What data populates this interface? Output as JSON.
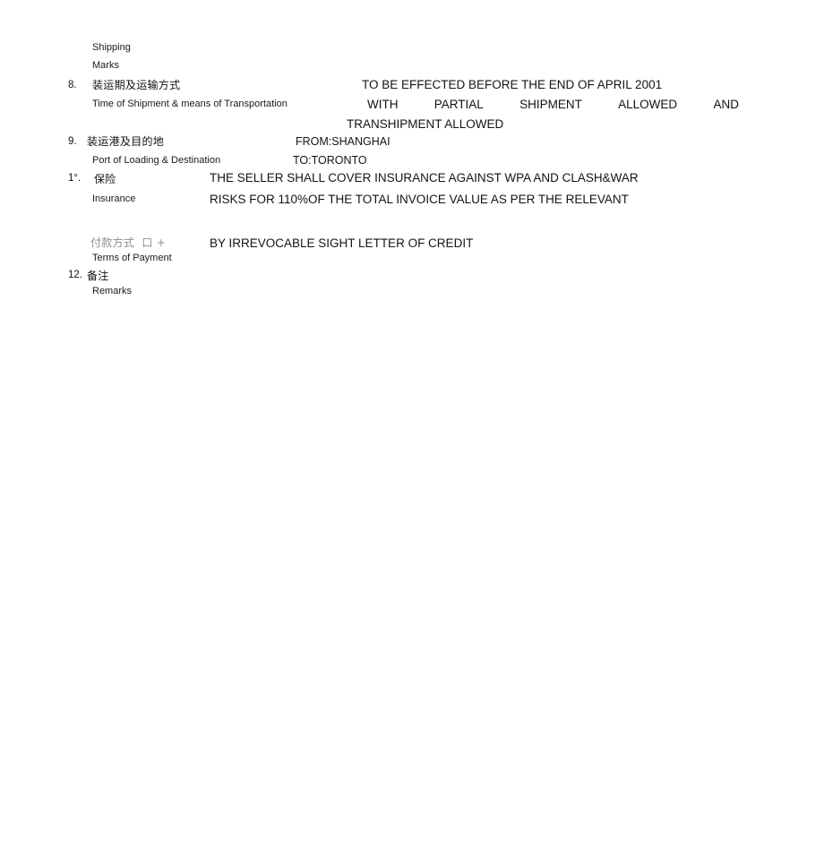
{
  "document": {
    "type": "sales-contract-fragment",
    "page_background": "#ffffff",
    "text_color": "#141414",
    "faded_color": "#8d8d8d"
  },
  "shipping_marks": {
    "line1": "Shipping",
    "line2": "Marks"
  },
  "items": [
    {
      "number": "8.",
      "label_cn": "装运期及运输方式",
      "label_en": "Time of Shipment & means of Transportation",
      "value_lines": [
        "TO BE EFFECTED BEFORE THE END OF APRIL 2001",
        "TRANSHIPMENT ALLOWED"
      ],
      "value_justified_words": [
        "WITH",
        "PARTIAL",
        "SHIPMENT",
        "ALLOWED",
        "AND"
      ]
    },
    {
      "number": "9.",
      "label_cn": "装运港及目的地",
      "label_en": "Port of Loading & Destination",
      "value_lines": [
        "FROM:SHANGHAI",
        "TO:TORONTO"
      ]
    },
    {
      "number": "1°.",
      "label_cn": "保险",
      "label_en": "Insurance",
      "value_lines": [
        "THE SELLER SHALL COVER INSURANCE AGAINST WPA AND CLASH&WAR",
        "RISKS FOR 110%OF THE TOTAL INVOICE VALUE AS PER THE RELEVANT"
      ]
    },
    {
      "number": "",
      "label_cn": "付款方式  口 +",
      "label_en": "Terms of Payment",
      "label_faded": true,
      "value_lines": [
        "BY IRREVOCABLE SIGHT LETTER OF CREDIT"
      ]
    },
    {
      "number": "12.",
      "label_cn": "备注",
      "label_en": "Remarks",
      "value_lines": []
    }
  ]
}
